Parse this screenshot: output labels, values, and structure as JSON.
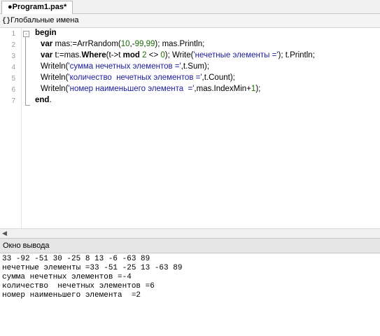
{
  "tab": {
    "label": "●Program1.pas*"
  },
  "scope": {
    "icon": "braces-icon",
    "icon_text": "{}",
    "label": "Глобальные имена"
  },
  "editor": {
    "line_numbers": [
      "1",
      "2",
      "3",
      "4",
      "5",
      "6",
      "7"
    ],
    "code": {
      "l1_begin": "begin",
      "l2_var": "var",
      "l2_a": " mas:=ArrRandom(",
      "l2_n1": "10",
      "l2_c1": ",-",
      "l2_n2": "99",
      "l2_c2": ",",
      "l2_n3": "99",
      "l2_b": "); mas.Println;",
      "l3_var": "var",
      "l3_a": " t:=mas.",
      "l3_where": "Where",
      "l3_b": "(t->t ",
      "l3_mod": "mod",
      "l3_c": " ",
      "l3_n1": "2",
      "l3_d": " <> ",
      "l3_n2": "0",
      "l3_e": "); Write(",
      "l3_s": "'нечетные элементы ='",
      "l3_f": "); t.Println;",
      "l4_a": "Writeln(",
      "l4_s": "'сумма нечетных элементов ='",
      "l4_b": ",t.Sum);",
      "l5_a": "Writeln(",
      "l5_s": "'количество  нечетных элементов ='",
      "l5_b": ",t.Count);",
      "l6_a": "Writeln(",
      "l6_s": "'номер наименьшего элемента  ='",
      "l6_b": ",mas.IndexMin+",
      "l6_n": "1",
      "l6_c": ");",
      "l7_end": "end",
      "l7_dot": "."
    }
  },
  "output": {
    "title": "Окно вывода",
    "lines": [
      "33 -92 -51 30 -25 8 13 -6 -63 89",
      "нечетные элементы =33 -51 -25 13 -63 89",
      "сумма нечетных элементов =-4",
      "количество  нечетных элементов =6",
      "номер наименьшего элемента  =2"
    ]
  }
}
